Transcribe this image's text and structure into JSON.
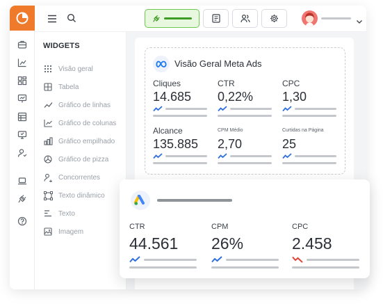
{
  "widgets": {
    "title": "WIDGETS",
    "items": [
      {
        "label": "Visão geral",
        "icon": "grid-dots-icon"
      },
      {
        "label": "Tabela",
        "icon": "table-icon"
      },
      {
        "label": "Gráfico de linhas",
        "icon": "line-chart-icon"
      },
      {
        "label": "Gráfico de colunas",
        "icon": "column-chart-icon"
      },
      {
        "label": "Gráfico empilhado",
        "icon": "stacked-chart-icon"
      },
      {
        "label": "Gráfico de pizza",
        "icon": "pie-chart-icon"
      },
      {
        "label": "Concorrentes",
        "icon": "competitors-icon"
      },
      {
        "label": "Texto dinâmico",
        "icon": "dynamic-text-icon"
      },
      {
        "label": "Texto",
        "icon": "text-icon"
      },
      {
        "label": "Imagem",
        "icon": "image-icon"
      }
    ]
  },
  "meta_card": {
    "title": "Visão Geral Meta Ads",
    "metrics": [
      {
        "label": "Cliques",
        "value": "14.685",
        "trend": "up"
      },
      {
        "label": "CTR",
        "value": "0,22%",
        "trend": "up"
      },
      {
        "label": "CPC",
        "value": "1,30",
        "trend": "up"
      },
      {
        "label": "Alcance",
        "value": "135.885",
        "trend": "up"
      },
      {
        "label": "CPM Médio",
        "value": "2,70",
        "trend": "up"
      },
      {
        "label": "Curtidas na Página",
        "value": "25",
        "trend": "up"
      }
    ]
  },
  "ads_card": {
    "metrics": [
      {
        "label": "CTR",
        "value": "44.561",
        "trend": "up"
      },
      {
        "label": "CPM",
        "value": "26%",
        "trend": "up"
      },
      {
        "label": "CPC",
        "value": "2.458",
        "trend": "down"
      }
    ]
  },
  "colors": {
    "brand": "#f07a2c",
    "trend_up": "#2f6fe0",
    "trend_down": "#e0453a",
    "active_button_bg": "#e7f8df",
    "active_button_border": "#6cc74c"
  }
}
